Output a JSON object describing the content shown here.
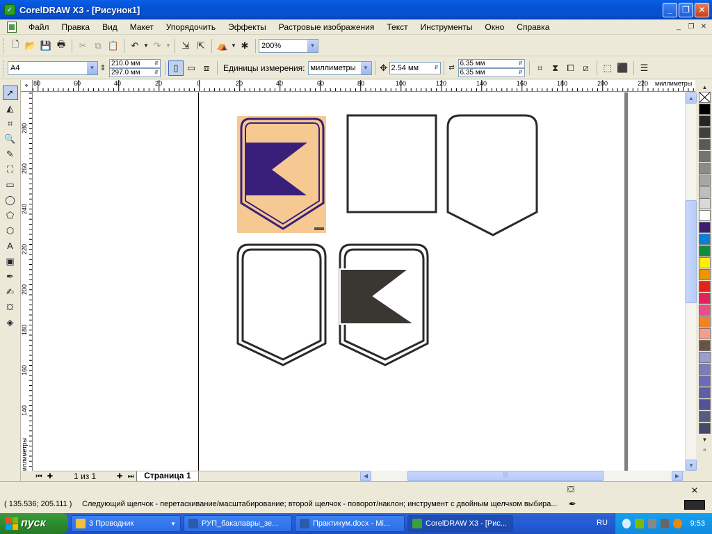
{
  "window": {
    "title": "CorelDRAW X3 - [Рисунок1]",
    "minimize": "_",
    "maximize": "❐",
    "close": "✕"
  },
  "menu": {
    "items": [
      "Файл",
      "Правка",
      "Вид",
      "Макет",
      "Упорядочить",
      "Эффекты",
      "Растровые изображения",
      "Текст",
      "Инструменты",
      "Окно",
      "Справка"
    ]
  },
  "toolbar": {
    "zoom": "200%"
  },
  "propertybar": {
    "paper": "A4",
    "width": "210.0 мм",
    "height": "297.0 мм",
    "units_label": "Единицы измерения:",
    "units": "миллиметры",
    "nudge": "2.54 мм",
    "dup_x": "6.35 мм",
    "dup_y": "6.35 мм"
  },
  "ruler": {
    "h_ticks": [
      "80",
      "60",
      "40",
      "20",
      "0",
      "20",
      "40",
      "60",
      "80",
      "100",
      "120",
      "140",
      "160",
      "180",
      "200",
      "220"
    ],
    "h_unit": "миллиметры",
    "v_ticks": [
      "280",
      "260",
      "240",
      "220",
      "200",
      "180",
      "160",
      "140"
    ],
    "v_unit": "миллиметры"
  },
  "palette": {
    "colors": [
      "#000000",
      "#262626",
      "#404040",
      "#595959",
      "#737373",
      "#8c8c8c",
      "#a6a6a6",
      "#bfbfbf",
      "#d9d9d9",
      "#ffffff",
      "#3d1c74",
      "#0a7fd9",
      "#108a3c",
      "#ffee00",
      "#f29400",
      "#e4221a",
      "#e0235a",
      "#ec4d8c",
      "#f58220",
      "#f29e8a",
      "#6b5344",
      "#9e9bd0",
      "#7d7bc0",
      "#6a6bb8",
      "#5b5ea8",
      "#4f5595",
      "#575d80",
      "#45486a"
    ]
  },
  "pages": {
    "count": "1 из 1",
    "tab": "Страница 1"
  },
  "status": {
    "coords": "( 135.536; 205.111 )",
    "hint": "Следующий щелчок - перетаскивание/масштабирование; второй щелчок - поворот/наклон; инструмент с двойным щелчком выбира..."
  },
  "taskbar": {
    "start": "пуск",
    "tasks": [
      {
        "label": "3 Проводник",
        "color": "#f0c040"
      },
      {
        "label": "РУП_бакалавры_зе...",
        "color": "#2a5caa"
      },
      {
        "label": "Практикум.docx - Mi...",
        "color": "#2a5caa"
      },
      {
        "label": "CorelDRAW X3 - [Рис...",
        "color": "#3aa23a"
      }
    ],
    "lang": "RU",
    "clock": "9:53"
  }
}
